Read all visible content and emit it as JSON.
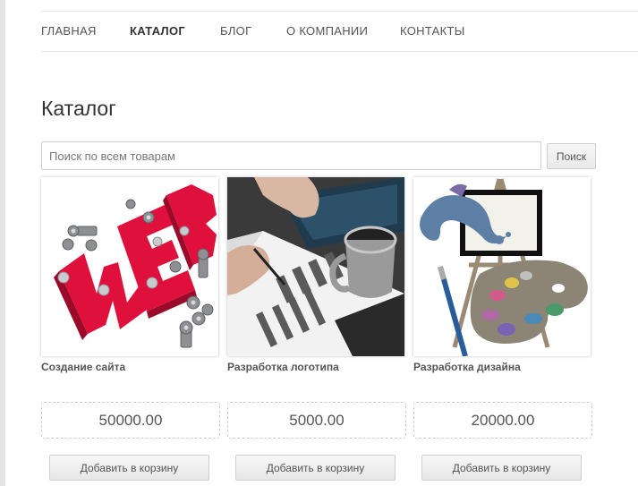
{
  "nav": {
    "items": [
      {
        "label": "ГЛАВНАЯ",
        "active": false
      },
      {
        "label": "КАТАЛОГ",
        "active": true
      },
      {
        "label": "БЛОГ",
        "active": false
      },
      {
        "label": "О КОМПАНИИ",
        "active": false
      },
      {
        "label": "КОНТАКТЫ",
        "active": false
      }
    ]
  },
  "page": {
    "title": "Каталог"
  },
  "search": {
    "placeholder": "Поиск по всем товарам",
    "value": "",
    "button_label": "Поиск"
  },
  "products": [
    {
      "name": "Создание сайта",
      "price": "50000.00",
      "button_label": "Добавить в корзину",
      "image_icon": "web-bolts-icon"
    },
    {
      "name": "Разработка логотипа",
      "price": "5000.00",
      "button_label": "Добавить в корзину",
      "image_icon": "logo-sketch-icon"
    },
    {
      "name": "Разработка дизайна",
      "price": "20000.00",
      "button_label": "Добавить в корзину",
      "image_icon": "easel-palette-icon"
    }
  ],
  "colors": {
    "accent_red": "#e0103c",
    "text": "#333333",
    "border": "#cfcfcf"
  }
}
